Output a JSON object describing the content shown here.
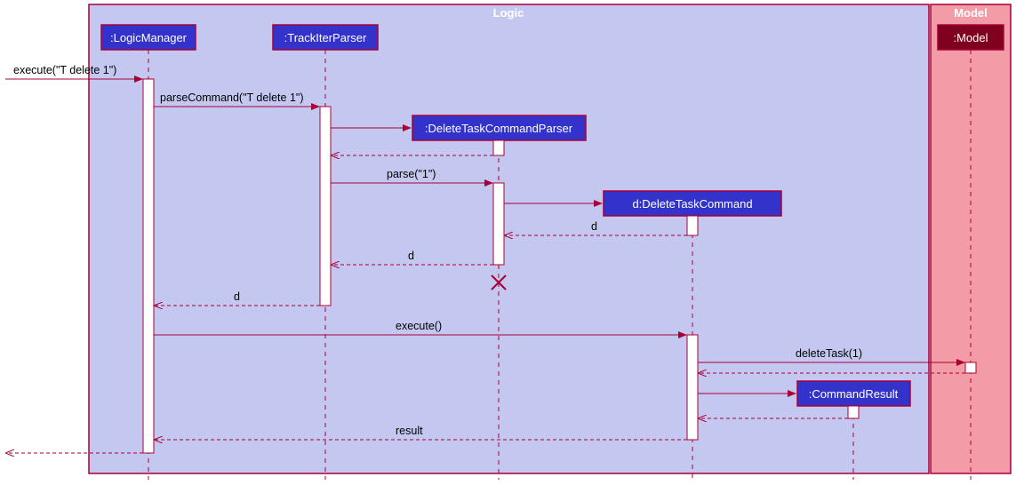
{
  "diagram": {
    "type": "uml-sequence",
    "frames": {
      "logic": {
        "title": "Logic"
      },
      "model": {
        "title": "Model"
      }
    },
    "participants": {
      "logicManager": ":LogicManager",
      "trackIterParser": ":TrackIterParser",
      "deleteTaskCommandParser": ":DeleteTaskCommandParser",
      "deleteTaskCommand": "d:DeleteTaskCommand",
      "commandResult": ":CommandResult",
      "model": ":Model"
    },
    "messages": {
      "m1": "execute(\"T delete 1\")",
      "m2": "parseCommand(\"T delete 1\")",
      "m3": "parse(\"1\")",
      "m4": "d",
      "m5": "d",
      "m6": "d",
      "m7": "execute()",
      "m8": "deleteTask(1)",
      "m9": "result"
    }
  }
}
